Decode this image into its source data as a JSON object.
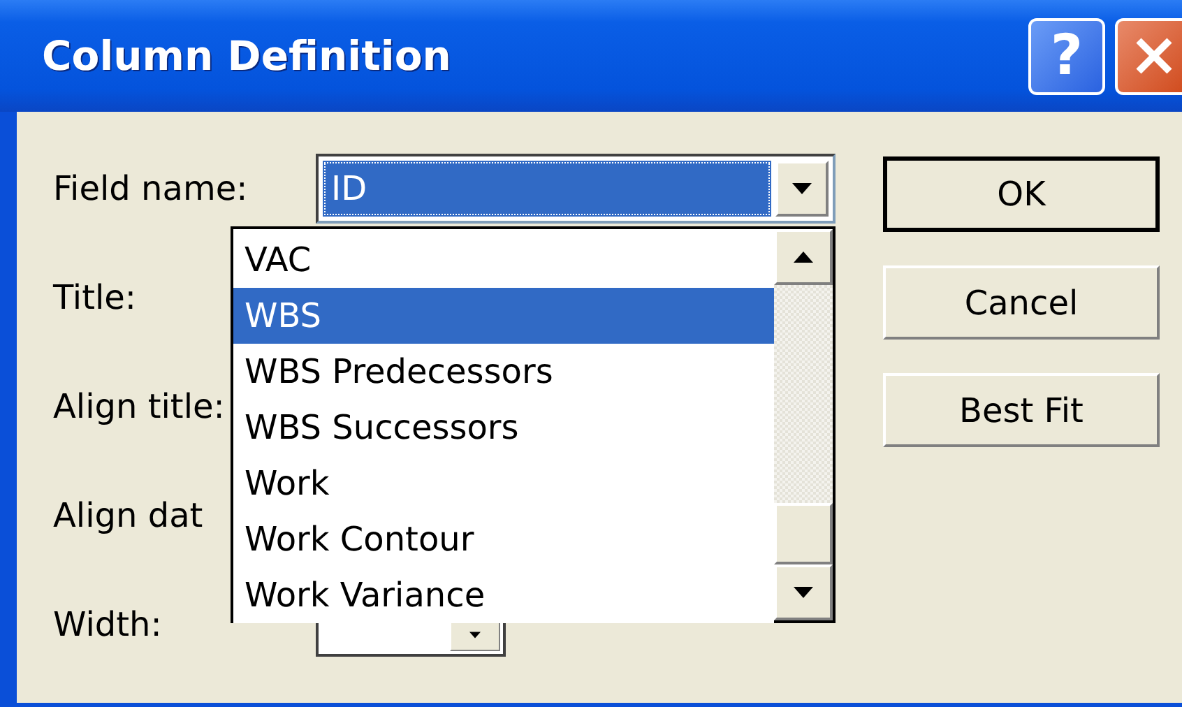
{
  "window": {
    "title": "Column Definition",
    "help_glyph": "?"
  },
  "form": {
    "labels": [
      "Field name:",
      "Title:",
      "Align title:",
      "Align dat",
      "Width:"
    ],
    "field_name": {
      "value": "ID"
    },
    "dropdown_list": [
      {
        "label": "VAC",
        "selected": false
      },
      {
        "label": "WBS",
        "selected": true
      },
      {
        "label": "WBS Predecessors",
        "selected": false
      },
      {
        "label": "WBS Successors",
        "selected": false
      },
      {
        "label": "Work",
        "selected": false
      },
      {
        "label": "Work Contour",
        "selected": false
      },
      {
        "label": "Work Variance",
        "selected": false
      }
    ]
  },
  "buttons": [
    {
      "label": "OK",
      "default": true
    },
    {
      "label": "Cancel",
      "default": false
    },
    {
      "label": "Best Fit",
      "default": false
    }
  ]
}
